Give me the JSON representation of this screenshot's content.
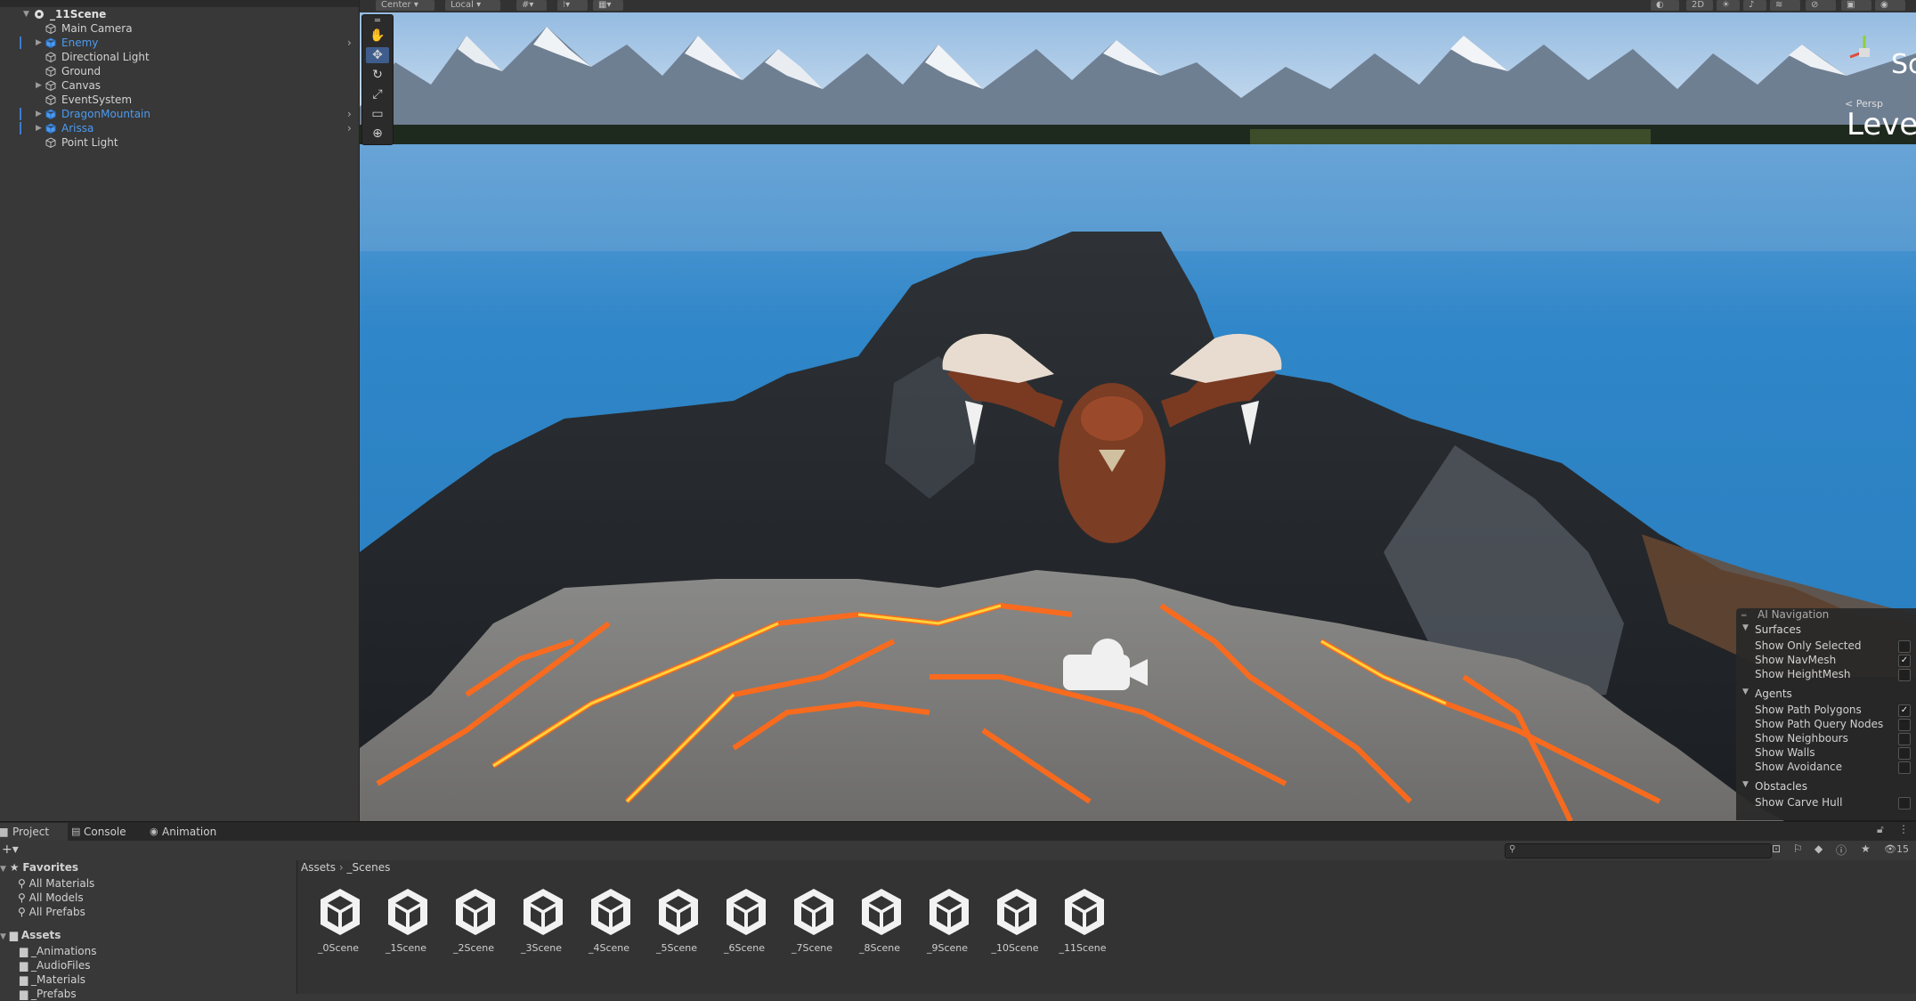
{
  "hierarchy": {
    "scene_name": "_11Scene",
    "items": [
      {
        "label": "Main Camera",
        "prefab": false,
        "expandable": false
      },
      {
        "label": "Enemy",
        "prefab": true,
        "expandable": true
      },
      {
        "label": "Directional Light",
        "prefab": false,
        "expandable": false
      },
      {
        "label": "Ground",
        "prefab": false,
        "expandable": false
      },
      {
        "label": "Canvas",
        "prefab": false,
        "expandable": true
      },
      {
        "label": "EventSystem",
        "prefab": false,
        "expandable": false
      },
      {
        "label": "DragonMountain",
        "prefab": true,
        "expandable": true
      },
      {
        "label": "Arissa",
        "prefab": true,
        "expandable": true
      },
      {
        "label": "Point Light",
        "prefab": false,
        "expandable": false
      }
    ]
  },
  "scene_toolbar": {
    "pivot": "Center",
    "space": "Local",
    "mode_2d": "2D"
  },
  "scene_overlay": {
    "persp": "< Persp",
    "level_text": "Leve",
    "sc_text": "Sc"
  },
  "ai_navigation": {
    "title": "AI Navigation",
    "sections": [
      {
        "name": "Surfaces",
        "items": [
          {
            "label": "Show Only Selected",
            "checked": false
          },
          {
            "label": "Show NavMesh",
            "checked": true
          },
          {
            "label": "Show HeightMesh",
            "checked": false
          }
        ]
      },
      {
        "name": "Agents",
        "items": [
          {
            "label": "Show Path Polygons",
            "checked": true
          },
          {
            "label": "Show Path Query Nodes",
            "checked": false
          },
          {
            "label": "Show Neighbours",
            "checked": false
          },
          {
            "label": "Show Walls",
            "checked": false
          },
          {
            "label": "Show Avoidance",
            "checked": false
          }
        ]
      },
      {
        "name": "Obstacles",
        "items": [
          {
            "label": "Show Carve Hull",
            "checked": false
          }
        ]
      }
    ]
  },
  "bottom_tabs": [
    "Project",
    "Console",
    "Animation"
  ],
  "project": {
    "favorites_label": "Favorites",
    "favorites": [
      "All Materials",
      "All Models",
      "All Prefabs"
    ],
    "assets_label": "Assets",
    "asset_folders": [
      "_Animations",
      "_AudioFiles",
      "_Materials",
      "_Prefabs"
    ],
    "breadcrumb": [
      "Assets",
      "_Scenes"
    ],
    "scenes": [
      "_0Scene",
      "_1Scene",
      "_2Scene",
      "_3Scene",
      "_4Scene",
      "_5Scene",
      "_6Scene",
      "_7Scene",
      "_8Scene",
      "_9Scene",
      "_10Scene",
      "_11Scene"
    ],
    "hidden_count": "15"
  }
}
